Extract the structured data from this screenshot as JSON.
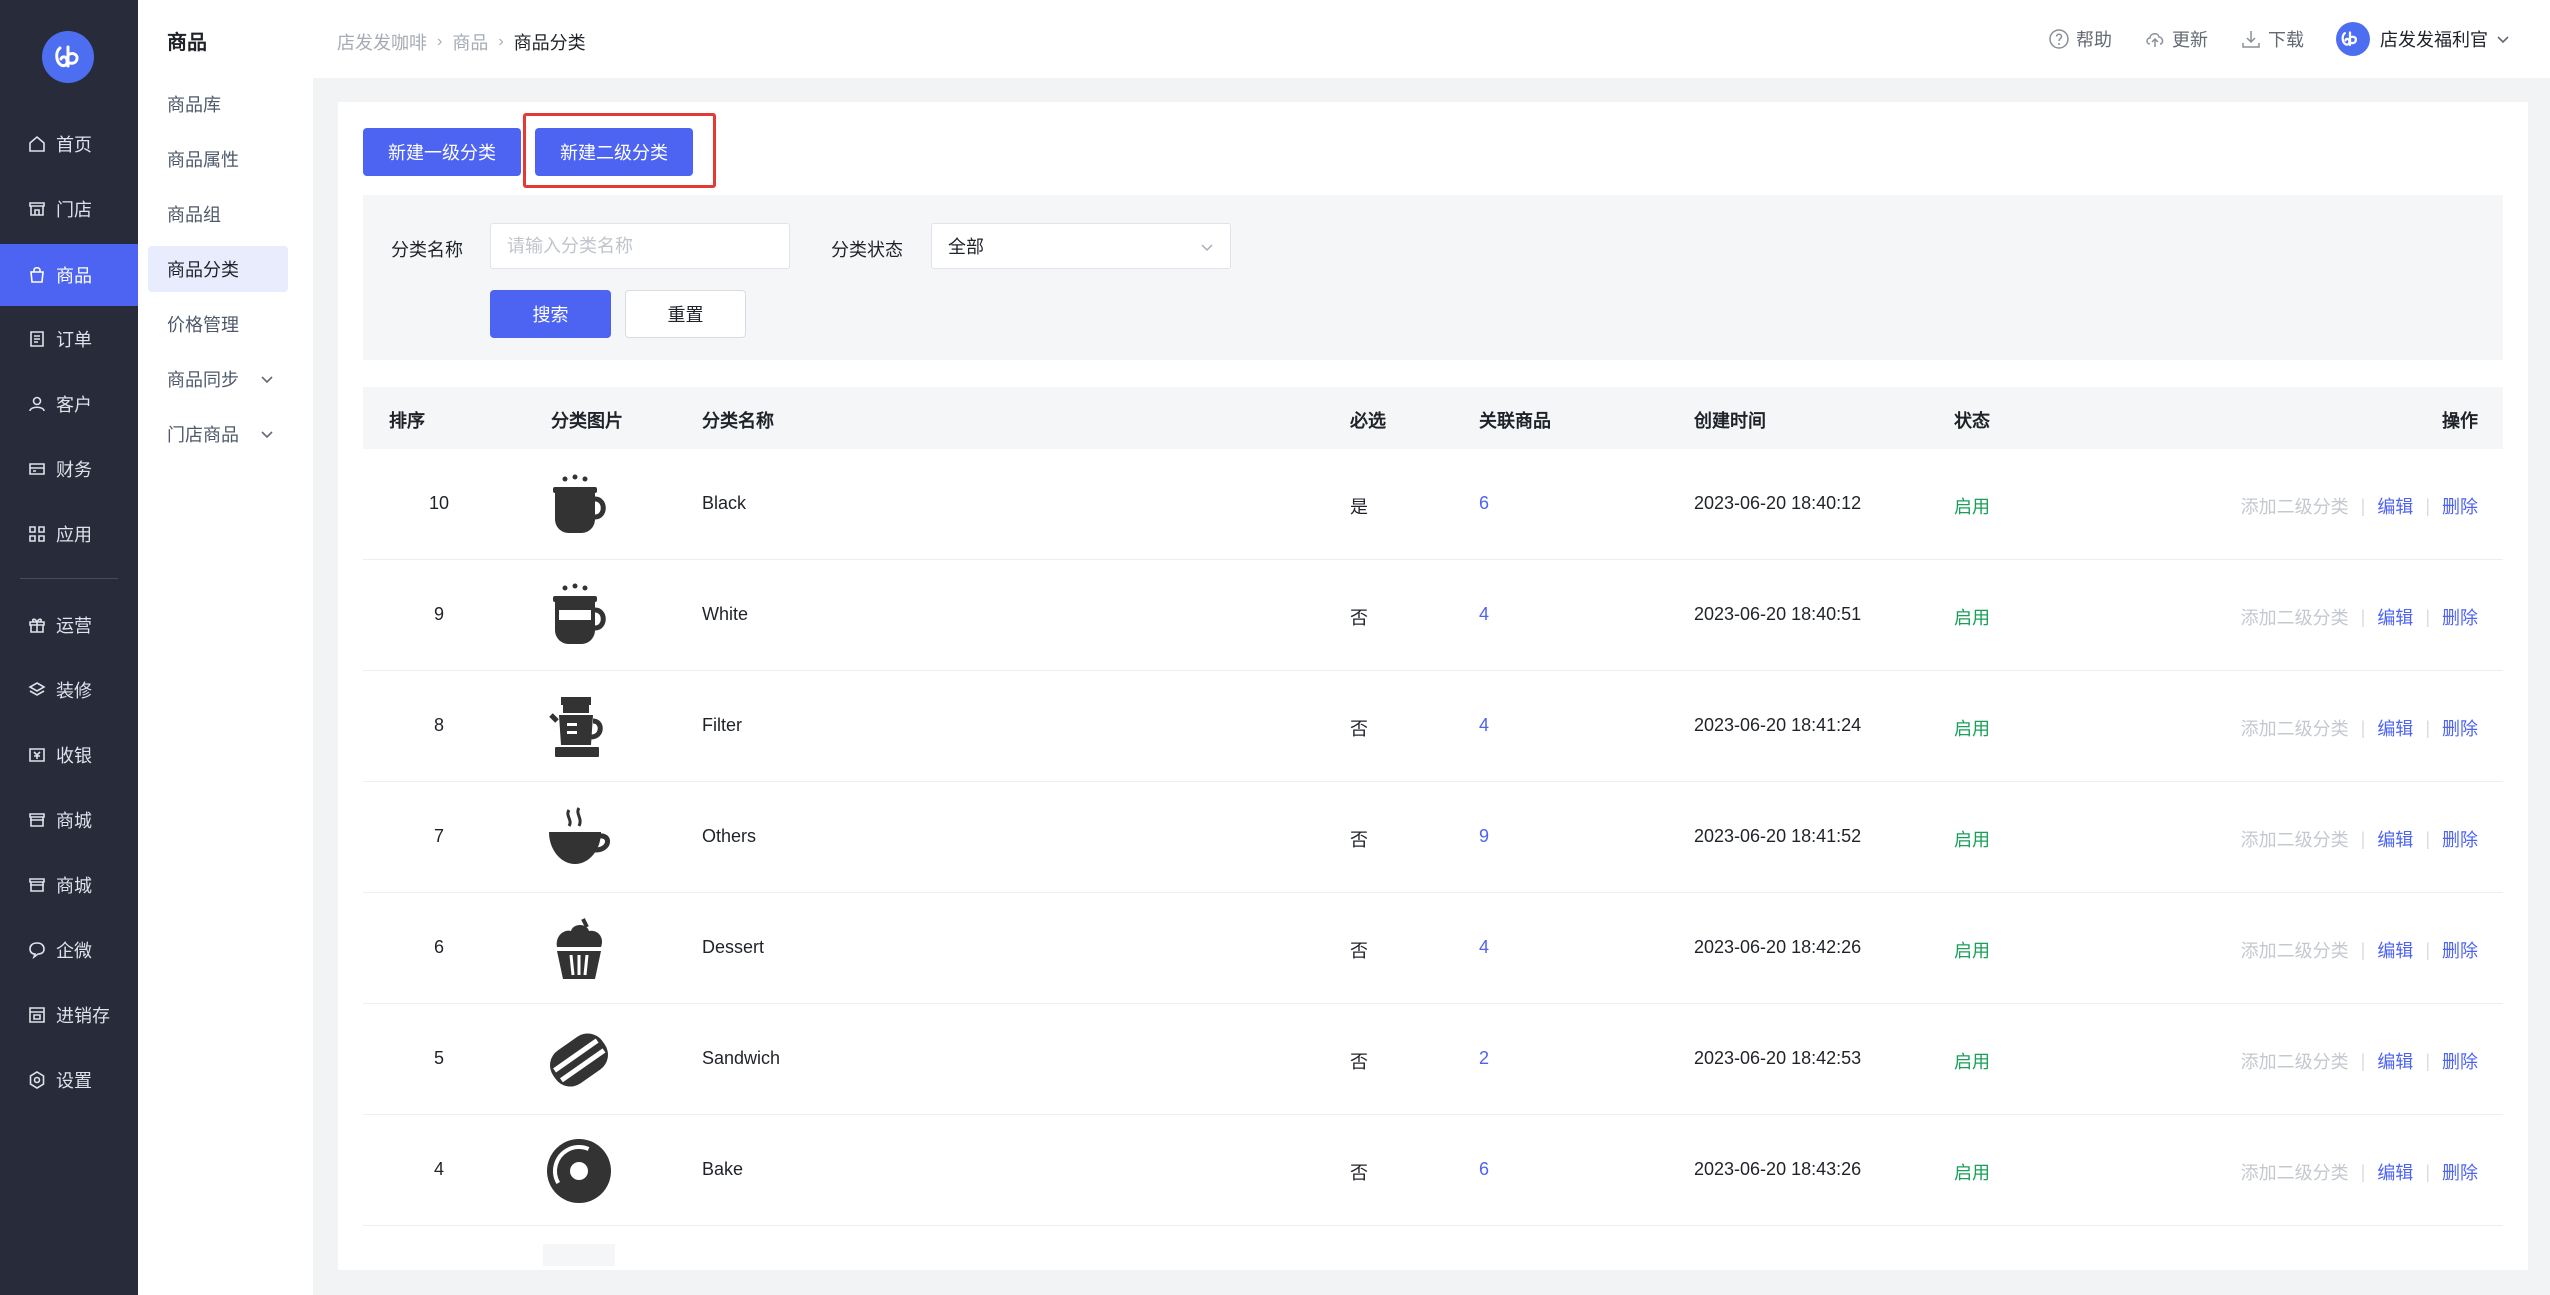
{
  "nav": {
    "items": [
      {
        "label": "首页",
        "icon": "home-icon"
      },
      {
        "label": "门店",
        "icon": "store-icon"
      },
      {
        "label": "商品",
        "icon": "bag-icon"
      },
      {
        "label": "订单",
        "icon": "order-icon"
      },
      {
        "label": "客户",
        "icon": "user-icon"
      },
      {
        "label": "财务",
        "icon": "card-icon"
      },
      {
        "label": "应用",
        "icon": "apps-icon"
      },
      {
        "label": "运营",
        "icon": "gift-icon"
      },
      {
        "label": "装修",
        "icon": "layers-icon"
      },
      {
        "label": "收银",
        "icon": "cashier-icon"
      },
      {
        "label": "商城",
        "icon": "shop-icon"
      },
      {
        "label": "商城",
        "icon": "shop-icon"
      },
      {
        "label": "企微",
        "icon": "chat-icon"
      },
      {
        "label": "进销存",
        "icon": "inventory-icon"
      },
      {
        "label": "设置",
        "icon": "settings-icon"
      }
    ],
    "active_index": 2,
    "colors": {
      "bg": "#272b3a",
      "active": "#4d63f2"
    }
  },
  "submenu": {
    "title": "商品",
    "items": [
      {
        "label": "商品库"
      },
      {
        "label": "商品属性"
      },
      {
        "label": "商品组"
      },
      {
        "label": "商品分类"
      },
      {
        "label": "价格管理"
      },
      {
        "label": "商品同步"
      },
      {
        "label": "门店商品"
      }
    ],
    "active_index": 3
  },
  "topbar": {
    "breadcrumb": [
      "店发发咖啡",
      "商品",
      "商品分类"
    ],
    "help": "帮助",
    "update": "更新",
    "download": "下载",
    "user": "店发发福利官"
  },
  "actions": {
    "new_level1": "新建一级分类",
    "new_level2": "新建二级分类"
  },
  "filter": {
    "name_label": "分类名称",
    "name_placeholder": "请输入分类名称",
    "status_label": "分类状态",
    "status_value": "全部",
    "search": "搜索",
    "reset": "重置"
  },
  "table": {
    "headers": {
      "sort": "排序",
      "image": "分类图片",
      "name": "分类名称",
      "required": "必选",
      "products": "关联商品",
      "created": "创建时间",
      "status": "状态",
      "ops": "操作"
    },
    "ops": {
      "add_sub": "添加二级分类",
      "edit": "编辑",
      "delete": "删除"
    },
    "rows": [
      {
        "sort": "10",
        "icon": "hot-coffee-cup-icon",
        "name": "Black",
        "required": "是",
        "count": "6",
        "time": "2023-06-20 18:40:12",
        "status": "启用"
      },
      {
        "sort": "9",
        "icon": "latte-cup-icon",
        "name": "White",
        "required": "否",
        "count": "4",
        "time": "2023-06-20 18:40:51",
        "status": "启用"
      },
      {
        "sort": "8",
        "icon": "coffee-maker-icon",
        "name": "Filter",
        "required": "否",
        "count": "4",
        "time": "2023-06-20 18:41:24",
        "status": "启用"
      },
      {
        "sort": "7",
        "icon": "teacup-icon",
        "name": "Others",
        "required": "否",
        "count": "9",
        "time": "2023-06-20 18:41:52",
        "status": "启用"
      },
      {
        "sort": "6",
        "icon": "cupcake-icon",
        "name": "Dessert",
        "required": "否",
        "count": "4",
        "time": "2023-06-20 18:42:26",
        "status": "启用"
      },
      {
        "sort": "5",
        "icon": "sandwich-icon",
        "name": "Sandwich",
        "required": "否",
        "count": "2",
        "time": "2023-06-20 18:42:53",
        "status": "启用"
      },
      {
        "sort": "4",
        "icon": "donut-icon",
        "name": "Bake",
        "required": "否",
        "count": "6",
        "time": "2023-06-20 18:43:26",
        "status": "启用"
      }
    ]
  }
}
